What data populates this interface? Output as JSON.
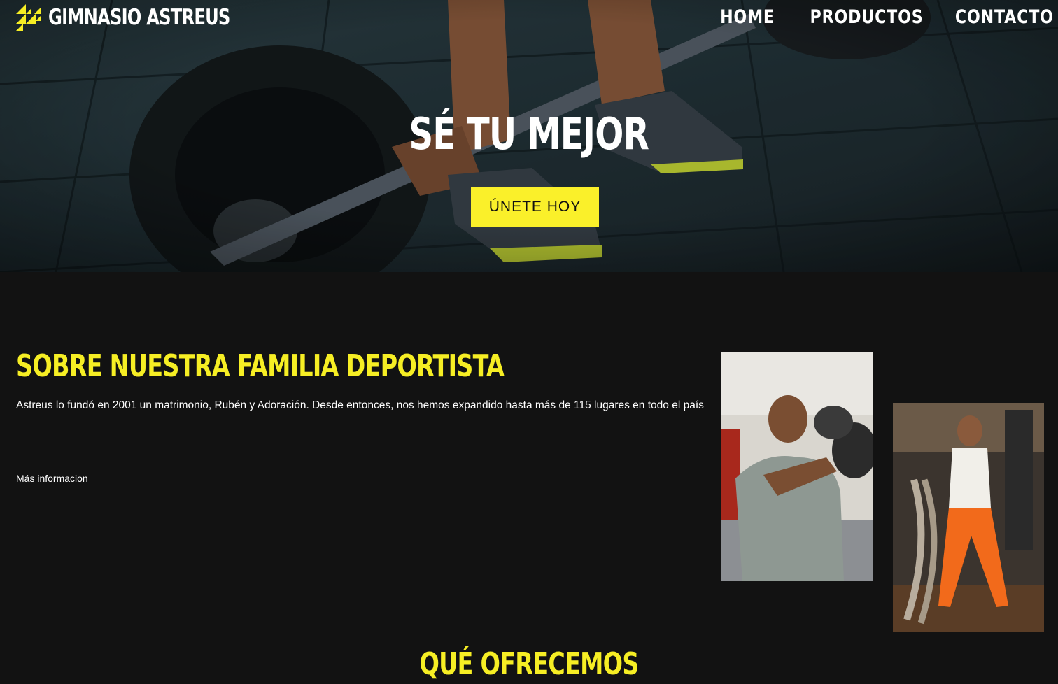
{
  "header": {
    "brand": "GIMNASIO ASTREUS",
    "nav": [
      "HOME",
      "PRODUCTOS",
      "CONTACTO"
    ]
  },
  "hero": {
    "title": "SÉ TU MEJOR",
    "cta_label": "ÚNETE HOY"
  },
  "about": {
    "title": "SOBRE NUESTRA FAMILIA DEPORTISTA",
    "text": "Astreus lo fundó en 2001 un matrimonio, Rubén y Adoración. Desde entonces, nos hemos expandido hasta más de 115 lugares en todo el país",
    "link_label": "Más informacion"
  },
  "offer": {
    "title": "QUÉ OFRECEMOS"
  },
  "colors": {
    "accent": "#f6ee24",
    "background": "#121212",
    "text": "#ffffff"
  },
  "icons": {
    "logo": "stair-triangles-logo-icon"
  }
}
